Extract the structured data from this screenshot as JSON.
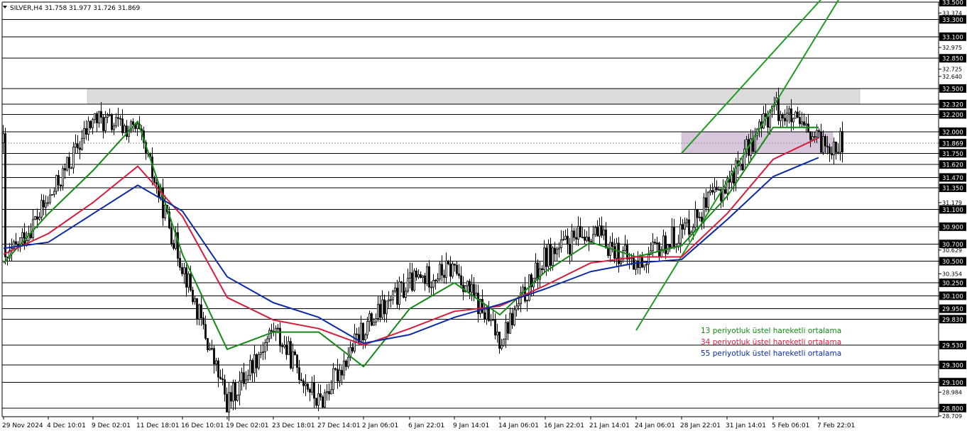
{
  "window": {
    "symbol_line": "SILVER,H4  31.758 31.977 31.726 31.869",
    "menu_icon": "triangle-down-icon"
  },
  "colors": {
    "background": "#ffffff",
    "candle": "#000000",
    "level_line": "#000000",
    "resistance_zone": "#dcdcdc",
    "support_zone": "#d8c6dc",
    "channel": "#1f9c1f",
    "ema13": "#138a13",
    "ema34": "#d81b3c",
    "ema55": "#0a2aa8",
    "label_box": "#000000",
    "label_text": "#ffffff"
  },
  "legend": [
    {
      "label": "13 periyotluk üstel hareketli ortalama",
      "color": "#138a13"
    },
    {
      "label": "34 periyotluk üstel hareketli ortalama",
      "color": "#d81b3c"
    },
    {
      "label": "55 periyotluk üstel hareketli ortalama",
      "color": "#0a2aa8"
    }
  ],
  "chart_data": {
    "type": "candlestick",
    "symbol": "SILVER",
    "timeframe": "H4",
    "ylim": [
      28.7,
      33.5
    ],
    "x_ticks": [
      "29 Nov 2024",
      "4 Dec 10:01",
      "9 Dec 02:01",
      "11 Dec 18:01",
      "16 Dec 10:01",
      "19 Dec 02:01",
      "23 Dec 18:01",
      "27 Dec 14:01",
      "2 Jan 06:01",
      "6 Jan 22:01",
      "9 Jan 14:01",
      "14 Jan 06:01",
      "16 Jan 22:01",
      "21 Jan 14:01",
      "24 Jan 06:01",
      "28 Jan 22:01",
      "31 Jan 14:01",
      "5 Feb 06:01",
      "7 Feb 22:01"
    ],
    "y_axis_labels": [
      "33.500",
      "33.374",
      "33.300",
      "33.100",
      "32.975",
      "32.850",
      "32.725",
      "32.640",
      "32.500",
      "32.320",
      "32.200",
      "32.000",
      "31.869",
      "31.750",
      "31.620",
      "31.470",
      "31.350",
      "31.179",
      "31.100",
      "30.900",
      "30.700",
      "30.629",
      "30.500",
      "30.354",
      "30.250",
      "30.100",
      "29.950",
      "29.830",
      "29.530",
      "29.300",
      "29.100",
      "28.984",
      "28.800",
      "28.709"
    ],
    "boxed_labels": [
      "33.500",
      "33.300",
      "33.100",
      "32.850",
      "32.500",
      "32.320",
      "32.200",
      "32.000",
      "31.869",
      "31.750",
      "31.620",
      "31.470",
      "31.350",
      "31.100",
      "30.900",
      "30.700",
      "30.500",
      "30.250",
      "30.100",
      "29.950",
      "29.830",
      "29.530",
      "29.300",
      "29.100",
      "28.800"
    ],
    "horizontal_levels": [
      33.5,
      33.3,
      33.1,
      32.85,
      32.5,
      32.32,
      32.2,
      32.0,
      31.75,
      31.62,
      31.47,
      31.35,
      31.1,
      30.9,
      30.7,
      30.5,
      30.25,
      30.1,
      29.95,
      29.83,
      29.53,
      29.3,
      29.1,
      28.8
    ],
    "current_price": 31.869,
    "zones": [
      {
        "name": "resistance",
        "x_start": "9 Dec 02:01",
        "x_end": "7 Feb 22:01",
        "low": 32.32,
        "high": 32.5
      },
      {
        "name": "support",
        "x_start": "28 Jan 22:01",
        "x_end": "7 Feb 22:01",
        "low": 31.75,
        "high": 32.0
      }
    ],
    "channel": [
      {
        "name": "upper",
        "from": [
          "28 Jan 22:01",
          31.75
        ],
        "to": [
          "7 Feb 22:01",
          33.5
        ]
      },
      {
        "name": "lower",
        "from": [
          "24 Jan 06:01",
          29.7
        ],
        "to": [
          "7 Feb 22:01",
          33.15
        ]
      }
    ],
    "series": [
      {
        "name": "13 periyotluk üstel hareketli ortalama",
        "color": "#138a13",
        "points": [
          [
            "29 Nov 2024",
            30.48
          ],
          [
            "4 Dec 10:01",
            31.05
          ],
          [
            "9 Dec 02:01",
            31.55
          ],
          [
            "11 Dec 18:01",
            32.12
          ],
          [
            "16 Dec 10:01",
            30.58
          ],
          [
            "19 Dec 02:01",
            29.48
          ],
          [
            "23 Dec 18:01",
            29.68
          ],
          [
            "27 Dec 14:01",
            29.68
          ],
          [
            "2 Jan 06:01",
            29.28
          ],
          [
            "6 Jan 22:01",
            29.95
          ],
          [
            "9 Jan 14:01",
            30.25
          ],
          [
            "14 Jan 06:01",
            29.88
          ],
          [
            "16 Jan 22:01",
            30.38
          ],
          [
            "21 Jan 14:01",
            30.72
          ],
          [
            "24 Jan 06:01",
            30.55
          ],
          [
            "28 Jan 22:01",
            30.68
          ],
          [
            "31 Jan 14:01",
            31.25
          ],
          [
            "5 Feb 06:01",
            32.05
          ],
          [
            "7 Feb 22:01",
            32.05
          ]
        ]
      },
      {
        "name": "34 periyotluk üstel hareketli ortalama",
        "color": "#d81b3c",
        "points": [
          [
            "29 Nov 2024",
            30.58
          ],
          [
            "4 Dec 10:01",
            30.82
          ],
          [
            "9 Dec 02:01",
            31.18
          ],
          [
            "11 Dec 18:01",
            31.6
          ],
          [
            "16 Dec 10:01",
            31.02
          ],
          [
            "19 Dec 02:01",
            30.08
          ],
          [
            "23 Dec 18:01",
            29.82
          ],
          [
            "27 Dec 14:01",
            29.72
          ],
          [
            "2 Jan 06:01",
            29.53
          ],
          [
            "6 Jan 22:01",
            29.72
          ],
          [
            "9 Jan 14:01",
            29.92
          ],
          [
            "14 Jan 06:01",
            29.98
          ],
          [
            "16 Jan 22:01",
            30.22
          ],
          [
            "21 Jan 14:01",
            30.48
          ],
          [
            "24 Jan 06:01",
            30.55
          ],
          [
            "28 Jan 22:01",
            30.55
          ],
          [
            "31 Jan 14:01",
            31.05
          ],
          [
            "5 Feb 06:01",
            31.68
          ],
          [
            "7 Feb 22:01",
            31.93
          ]
        ]
      },
      {
        "name": "55 periyotluk üstel hareketli ortalama",
        "color": "#0a2aa8",
        "points": [
          [
            "29 Nov 2024",
            30.65
          ],
          [
            "4 Dec 10:01",
            30.72
          ],
          [
            "9 Dec 02:01",
            31.05
          ],
          [
            "11 Dec 18:01",
            31.38
          ],
          [
            "16 Dec 10:01",
            31.08
          ],
          [
            "19 Dec 02:01",
            30.32
          ],
          [
            "23 Dec 18:01",
            30.02
          ],
          [
            "27 Dec 14:01",
            29.85
          ],
          [
            "2 Jan 06:01",
            29.55
          ],
          [
            "6 Jan 22:01",
            29.65
          ],
          [
            "9 Jan 14:01",
            29.85
          ],
          [
            "14 Jan 06:01",
            30.0
          ],
          [
            "16 Jan 22:01",
            30.18
          ],
          [
            "21 Jan 14:01",
            30.38
          ],
          [
            "24 Jan 06:01",
            30.48
          ],
          [
            "28 Jan 22:01",
            30.52
          ],
          [
            "31 Jan 14:01",
            30.98
          ],
          [
            "5 Feb 06:01",
            31.48
          ],
          [
            "7 Feb 22:01",
            31.7
          ]
        ]
      }
    ],
    "price_path": [
      [
        "29 Nov 2024",
        30.45
      ],
      [
        "4 Dec 10:01",
        31.2
      ],
      [
        "9 Dec 02:01",
        32.15
      ],
      [
        "11 Dec 18:01",
        32.0
      ],
      [
        "16 Dec 10:01",
        30.45
      ],
      [
        "19 Dec 02:01",
        28.85
      ],
      [
        "23 Dec 18:01",
        29.72
      ],
      [
        "27 Dec 14:01",
        28.85
      ],
      [
        "2 Jan 06:01",
        29.72
      ],
      [
        "6 Jan 22:01",
        30.25
      ],
      [
        "9 Jan 14:01",
        30.42
      ],
      [
        "14 Jan 06:01",
        29.6
      ],
      [
        "16 Jan 22:01",
        30.55
      ],
      [
        "21 Jan 14:01",
        30.85
      ],
      [
        "24 Jan 06:01",
        30.45
      ],
      [
        "28 Jan 22:01",
        30.85
      ],
      [
        "31 Jan 14:01",
        31.4
      ],
      [
        "5 Feb 06:01",
        32.3
      ],
      [
        "7 Feb 22:01",
        31.87
      ]
    ]
  }
}
